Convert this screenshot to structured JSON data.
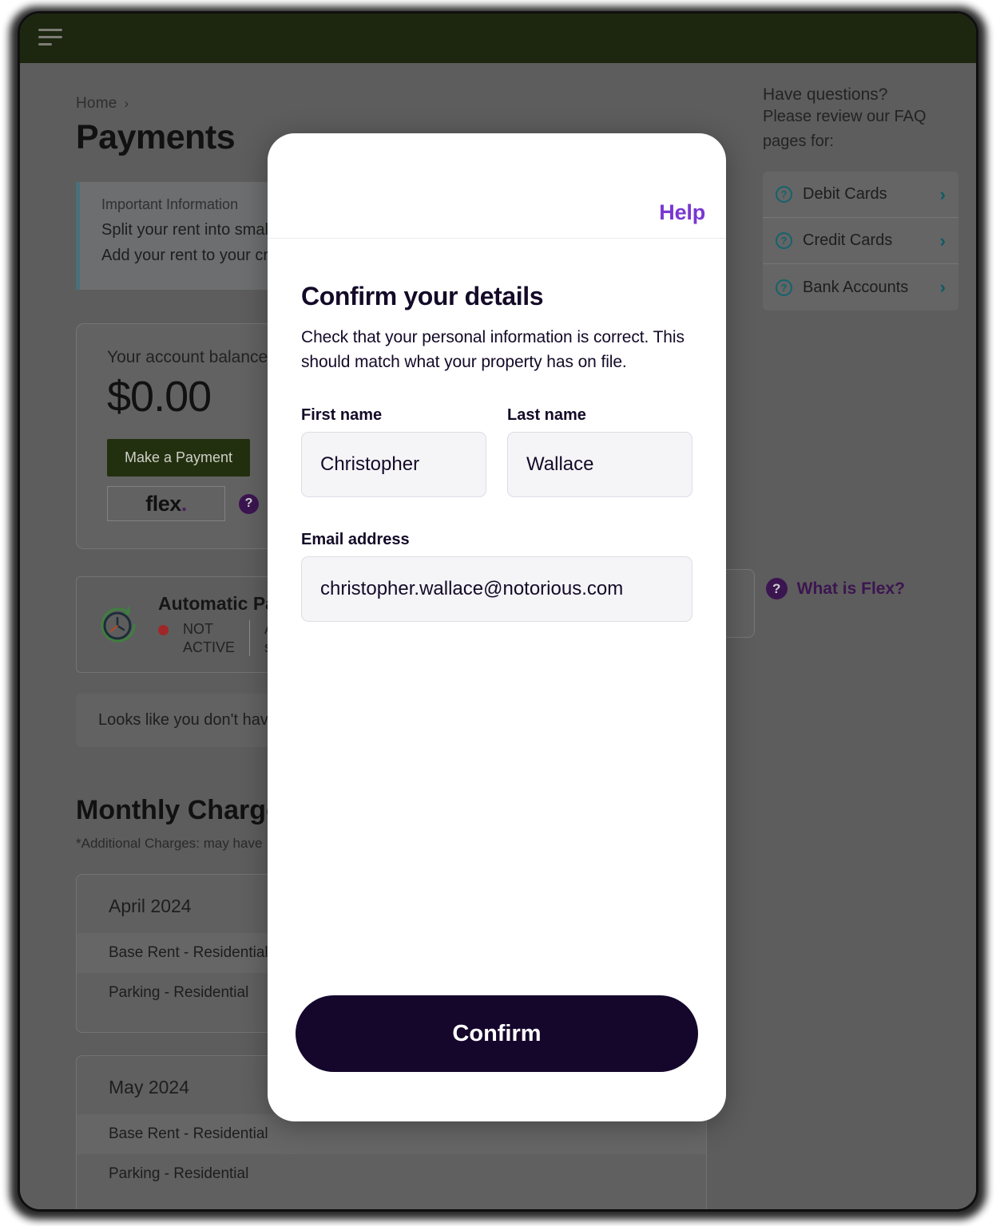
{
  "appbar": {
    "menu_icon": "hamburger-menu-icon"
  },
  "breadcrumb": {
    "home": "Home",
    "chevron": "›"
  },
  "page": {
    "title": "Payments"
  },
  "info_box": {
    "title": "Important Information",
    "line1": "Split your rent into smaller, s",
    "line2": "Add your rent to your credit"
  },
  "balance": {
    "label": "Your account balance",
    "amount": "$0.00",
    "make_payment": "Make a Payment",
    "flex_logo": "flex",
    "flex_dot": ".",
    "help_badge": "?"
  },
  "autopay": {
    "title": "Automatic Pa",
    "status": "NOT\nACTIVE",
    "status_line1": "NOT",
    "status_line2": "ACTIVE",
    "detail_line1": "Av",
    "detail_line2": "se",
    "icon": "clock-refresh-icon"
  },
  "empty_note": "Looks like you don't have",
  "monthly": {
    "heading": "Monthly Charges",
    "subnote": "*Additional Charges: may have",
    "months": [
      {
        "name": "April 2024",
        "charges": [
          "Base Rent - Residential",
          "Parking - Residential"
        ]
      },
      {
        "name": "May 2024",
        "charges": [
          "Base Rent - Residential",
          "Parking - Residential"
        ]
      }
    ]
  },
  "rail": {
    "heading": "Have questions?",
    "subtext": "Please review our FAQ pages for:",
    "faq_items": [
      {
        "label": "Debit Cards",
        "icon": "question-circle-icon",
        "chevron": "›"
      },
      {
        "label": "Credit Cards",
        "icon": "question-circle-icon",
        "chevron": "›"
      },
      {
        "label": "Bank Accounts",
        "icon": "question-circle-icon",
        "chevron": "›"
      }
    ],
    "question_glyph": "?"
  },
  "what_is_flex": {
    "label": "What is Flex?",
    "badge": "?"
  },
  "modal": {
    "help_label": "Help",
    "title": "Confirm your details",
    "description": "Check that your personal information is correct. This should match what your property has on file.",
    "fields": {
      "first_name": {
        "label": "First name",
        "value": "Christopher",
        "placeholder": "First name"
      },
      "last_name": {
        "label": "Last name",
        "value": "Wallace",
        "placeholder": "Last name"
      },
      "email": {
        "label": "Email address",
        "value": "christopher.wallace@notorious.com",
        "placeholder": "Email address"
      }
    },
    "confirm_label": "Confirm"
  },
  "colors": {
    "accent_purple": "#7a37d0",
    "dark_navy": "#15062c",
    "appbar_green": "#1d2710",
    "teal": "#12636e",
    "status_red": "#a02727",
    "brand_dark_green": "#22300f"
  }
}
